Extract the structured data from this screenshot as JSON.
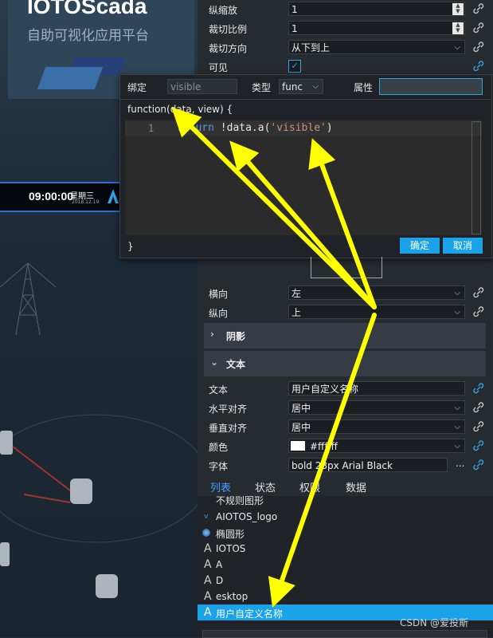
{
  "canvas": {
    "logo_title": "IOTOScada",
    "logo_subtitle": "自助可视化应用平台",
    "clock_time": "09:00:00",
    "clock_weekday": "星期三",
    "clock_date": "2018.12.19"
  },
  "props_top": [
    {
      "label": "纵缩放",
      "value": "1",
      "kind": "spinner"
    },
    {
      "label": "裁切比例",
      "value": "1",
      "kind": "spinner"
    },
    {
      "label": "裁切方向",
      "value": "从下到上",
      "kind": "select"
    },
    {
      "label": "可见",
      "value": "✓",
      "kind": "checkbox"
    }
  ],
  "binding_popup": {
    "bind_label": "绑定",
    "bind_placeholder": "visible",
    "type_label": "类型",
    "type_value": "func",
    "attr_label": "属性",
    "function_header": "function(data, view) {",
    "line_number": "1",
    "code_keyword": "return",
    "code_mid": " !data.a(",
    "code_string": "'visible'",
    "code_end": ")",
    "closing_brace": "}",
    "ok_label": "确定",
    "cancel_label": "取消"
  },
  "props_align": [
    {
      "label": "横向",
      "value": "左"
    },
    {
      "label": "纵向",
      "value": "上"
    }
  ],
  "sections": {
    "shadow": "阴影",
    "text": "文本"
  },
  "props_text": [
    {
      "label": "文本",
      "value": "用户自定义名称"
    },
    {
      "label": "水平对齐",
      "value": "居中"
    },
    {
      "label": "垂直对齐",
      "value": "居中"
    },
    {
      "label": "颜色",
      "value": "#ffffff"
    },
    {
      "label": "字体",
      "value": "bold 28px Arial Black"
    }
  ],
  "font_more": "...",
  "tabs": [
    "列表",
    "状态",
    "权限",
    "数据"
  ],
  "list_items": [
    {
      "icon": "irregular-shape-icon",
      "label": "不规则图形"
    },
    {
      "icon": "expand-icon",
      "label": "AIOTOS_logo"
    },
    {
      "icon": "ellipse-icon",
      "label": "椭圆形"
    },
    {
      "icon": "text-icon",
      "label": "IOTOS"
    },
    {
      "icon": "text-icon",
      "label": "A"
    },
    {
      "icon": "text-icon",
      "label": "D"
    },
    {
      "icon": "text-icon",
      "label": "esktop"
    },
    {
      "icon": "text-icon",
      "label": "用户自定义名称"
    }
  ],
  "watermark": "CSDN @爱投斯",
  "colors": {
    "accent": "#1aa3e8",
    "arrow": "#ffff00",
    "panel_bg": "#262b30",
    "selected_row": "#1aa3e8"
  }
}
